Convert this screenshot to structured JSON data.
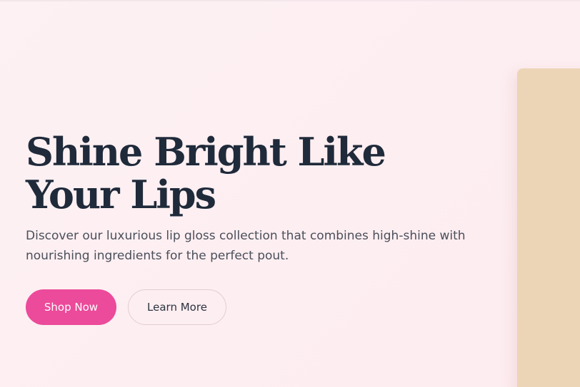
{
  "hero": {
    "title": "Shine Bright Like Your Lips",
    "subtitle": "Discover our luxurious lip gloss collection that combines high-shine with nourishing ingredients for the perfect pout.",
    "primary_button": "Shop Now",
    "secondary_button": "Learn More"
  },
  "colors": {
    "background": "#fdeff2",
    "title": "#1f2a3a",
    "primary_button": "#ec4a9a",
    "image_card": "#ecd4b6"
  }
}
